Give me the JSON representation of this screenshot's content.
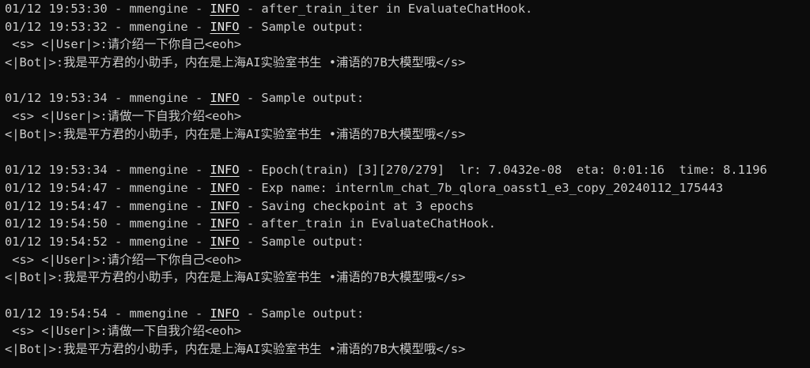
{
  "colors": {
    "background": "#0c0c0c",
    "text": "#cccccc"
  },
  "terminal": {
    "lines": [
      {
        "type": "log",
        "ts": "01/12 19:53:30",
        "logger": "mmengine",
        "level": "INFO",
        "msg": "after_train_iter in EvaluateChatHook."
      },
      {
        "type": "log",
        "ts": "01/12 19:53:32",
        "logger": "mmengine",
        "level": "INFO",
        "msg": "Sample output:"
      },
      {
        "type": "text",
        "text": " <s> <|User|>:请介绍一下你自己<eoh>"
      },
      {
        "type": "text",
        "text": "<|Bot|>:我是平方君的小助手，内在是上海AI实验室书生 •浦语的7B大模型哦</s>"
      },
      {
        "type": "blank",
        "text": ""
      },
      {
        "type": "log",
        "ts": "01/12 19:53:34",
        "logger": "mmengine",
        "level": "INFO",
        "msg": "Sample output:"
      },
      {
        "type": "text",
        "text": " <s> <|User|>:请做一下自我介绍<eoh>"
      },
      {
        "type": "text",
        "text": "<|Bot|>:我是平方君的小助手，内在是上海AI实验室书生 •浦语的7B大模型哦</s>"
      },
      {
        "type": "blank",
        "text": ""
      },
      {
        "type": "log",
        "ts": "01/12 19:53:34",
        "logger": "mmengine",
        "level": "INFO",
        "msg": "Epoch(train) [3][270/279]  lr: 7.0432e-08  eta: 0:01:16  time: 8.1196"
      },
      {
        "type": "log",
        "ts": "01/12 19:54:47",
        "logger": "mmengine",
        "level": "INFO",
        "msg": "Exp name: internlm_chat_7b_qlora_oasst1_e3_copy_20240112_175443"
      },
      {
        "type": "log",
        "ts": "01/12 19:54:47",
        "logger": "mmengine",
        "level": "INFO",
        "msg": "Saving checkpoint at 3 epochs"
      },
      {
        "type": "log",
        "ts": "01/12 19:54:50",
        "logger": "mmengine",
        "level": "INFO",
        "msg": "after_train in EvaluateChatHook."
      },
      {
        "type": "log",
        "ts": "01/12 19:54:52",
        "logger": "mmengine",
        "level": "INFO",
        "msg": "Sample output:"
      },
      {
        "type": "text",
        "text": " <s> <|User|>:请介绍一下你自己<eoh>"
      },
      {
        "type": "text",
        "text": "<|Bot|>:我是平方君的小助手，内在是上海AI实验室书生 •浦语的7B大模型哦</s>"
      },
      {
        "type": "blank",
        "text": ""
      },
      {
        "type": "log",
        "ts": "01/12 19:54:54",
        "logger": "mmengine",
        "level": "INFO",
        "msg": "Sample output:"
      },
      {
        "type": "text",
        "text": " <s> <|User|>:请做一下自我介绍<eoh>"
      },
      {
        "type": "text",
        "text": "<|Bot|>:我是平方君的小助手，内在是上海AI实验室书生 •浦语的7B大模型哦</s>"
      }
    ]
  }
}
